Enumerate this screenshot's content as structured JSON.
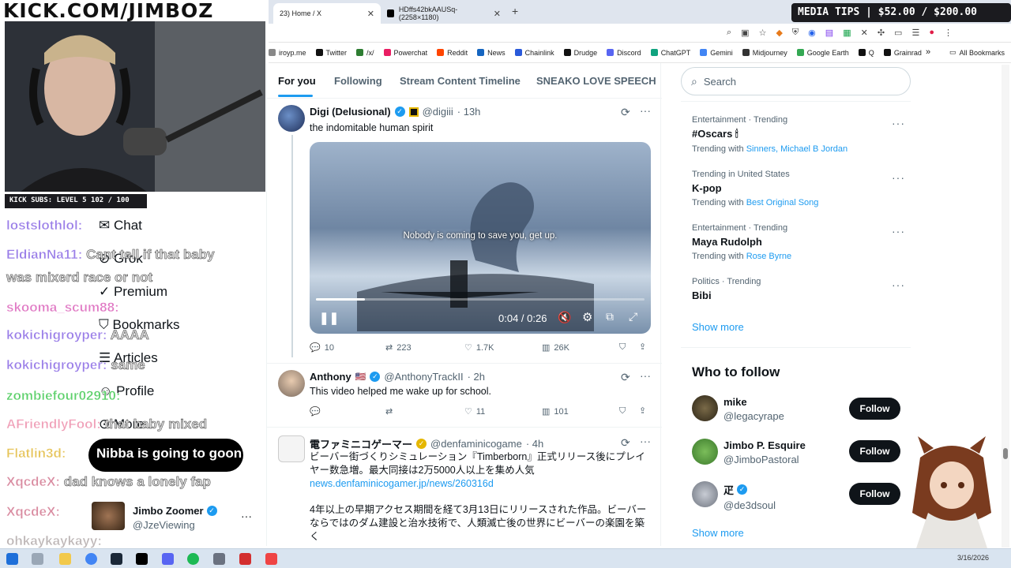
{
  "browser": {
    "tabs": [
      {
        "label": "23) Home / X",
        "icon": "x-logo-icon"
      },
      {
        "label": "HDffs42bkAAUSq- (2258×1180)",
        "icon": "x-logo-icon"
      }
    ],
    "new_tab": "+",
    "bookmarks": [
      "iroyp.me",
      "Twitter",
      "/x/",
      "Powerchat",
      "Reddit",
      "News",
      "Chainlink",
      "Drudge",
      "Discord",
      "ChatGPT",
      "Gemini",
      "Midjourney",
      "Google Earth",
      "Q",
      "Grainrad"
    ],
    "all_bookmarks": "All Bookmarks",
    "overflow": "»"
  },
  "overlay": {
    "logo": "KICK.COM/JIMBOZ",
    "media_tips": "MEDIA TIPS | $52.00 / $200.00",
    "kick_subs": "KICK SUBS: LEVEL 5 102 / 100",
    "chat": [
      {
        "user": "lostslothlol:",
        "msg": ""
      },
      {
        "user": "EldianNa11:",
        "msg": "Cant tell if that baby"
      },
      {
        "user": "",
        "msg": "was mixerd race or not"
      },
      {
        "user": "skooma_scum88:",
        "msg": ""
      },
      {
        "user": "kokichigroyper:",
        "msg": "AAAA"
      },
      {
        "user": "kokichigroyper:",
        "msg": "same"
      },
      {
        "user": "zombiefour02910:",
        "msg": ""
      },
      {
        "user": "AFriendlyFool:",
        "msg": "that baby mixed"
      },
      {
        "user": "Flatlin3d:",
        "msg": "Nibba is going to goon"
      },
      {
        "user": "XqcdeX:",
        "msg": "dad knows a lonely fap"
      },
      {
        "user": "XqcdeX:",
        "msg": ""
      },
      {
        "user": "ohkaykaykayy:",
        "msg": ""
      }
    ]
  },
  "x_nav": {
    "items": [
      "Chat",
      "Grok",
      "Premium",
      "Bookmarks",
      "Articles",
      "Profile",
      "More"
    ],
    "account": {
      "name": "Jimbo Zoomer",
      "handle": "@JzeViewing"
    }
  },
  "feed": {
    "tabs": [
      "For you",
      "Following",
      "Stream Content Timeline",
      "SNEAKO LOVE SPEECH"
    ],
    "tweets": [
      {
        "name": "Digi (Delusional)",
        "handle": "@digiii",
        "time": "· 13h",
        "text": "the indomitable human spirit",
        "video": {
          "caption": "Nobody is coming to save you, get up.",
          "time": "0:04 / 0:26",
          "progress": 0.15
        },
        "replies": "10",
        "reposts": "223",
        "likes": "1.7K",
        "views": "26K"
      },
      {
        "name": "Anthony",
        "flag": "🇺🇸",
        "handle": "@AnthonyTrackII",
        "time": "· 2h",
        "text": "This video helped me wake up for school.",
        "replies": "",
        "reposts": "",
        "likes": "11",
        "views": "101"
      },
      {
        "name": "電ファミニコゲーマー",
        "handle": "@denfaminicogame",
        "time": "· 4h",
        "text1": "ビーバー街づくりシミュレーション『Timberborn』正式リリース後にプレイヤー数急増。最大同接は2万5000人以上を集め人気",
        "link": "news.denfaminicogamer.jp/news/260316d",
        "text2": "4年以上の早期アクセス期間を経て3月13日にリリースされた作品。ビーバーならではのダム建設と治水技術で、人類滅亡後の世界にビーバーの楽園を築く"
      }
    ]
  },
  "sidebar": {
    "search_placeholder": "Search",
    "trends": [
      {
        "category": "Entertainment · Trending",
        "title": "#Oscars 🕯",
        "with_label": "Trending with",
        "with": "Sinners, Michael B Jordan"
      },
      {
        "category": "Trending in United States",
        "title": "K-pop",
        "with_label": "Trending with",
        "with": "Best Original Song"
      },
      {
        "category": "Entertainment · Trending",
        "title": "Maya Rudolph",
        "with_label": "Trending with",
        "with": "Rose Byrne"
      },
      {
        "category": "Politics · Trending",
        "title": "Bibi",
        "with_label": "",
        "with": ""
      }
    ],
    "show_more": "Show more",
    "who_to_follow": "Who to follow",
    "follow": [
      {
        "name": "mike",
        "handle": "@legacyrape"
      },
      {
        "name": "Jimbo P. Esquire",
        "handle": "@JimboPastoral"
      },
      {
        "name": "疋",
        "handle": "@de3dsoul"
      }
    ],
    "follow_label": "Follow",
    "show_more_2": "Show more"
  },
  "taskbar": {
    "clock": "3/16/2026"
  }
}
